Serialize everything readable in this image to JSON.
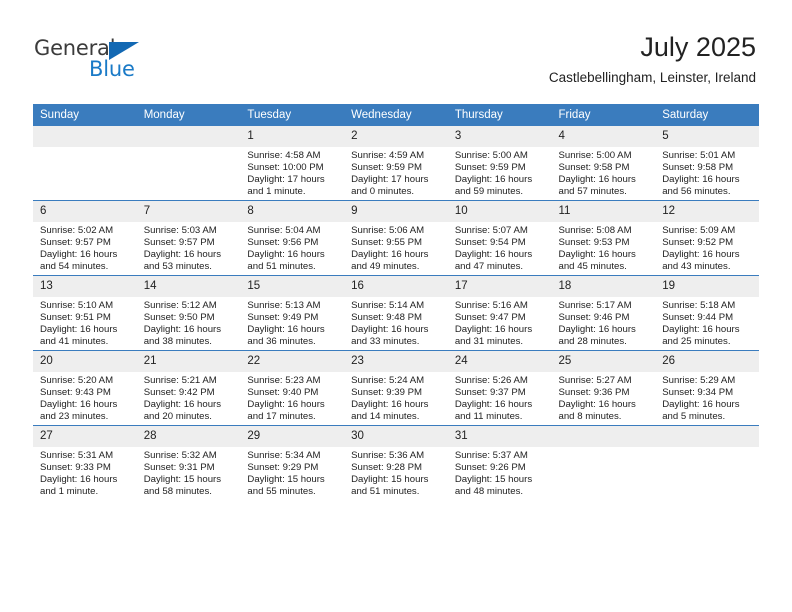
{
  "brand": {
    "name_top": "General",
    "name_bottom": "Blue",
    "accent_color": "#1a7ac7",
    "triangle_color": "#1268b3"
  },
  "header": {
    "title": "July 2025",
    "subtitle": "Castlebellingham, Leinster, Ireland"
  },
  "theme": {
    "header_bg": "#3a7cbe",
    "daynum_bg": "#eeeeee",
    "text": "#222222"
  },
  "weekday_headers": [
    "Sunday",
    "Monday",
    "Tuesday",
    "Wednesday",
    "Thursday",
    "Friday",
    "Saturday"
  ],
  "weeks": [
    [
      {
        "day": "",
        "sunrise": "",
        "sunset": "",
        "daylight1": "",
        "daylight2": "",
        "empty": true
      },
      {
        "day": "",
        "sunrise": "",
        "sunset": "",
        "daylight1": "",
        "daylight2": "",
        "empty": true
      },
      {
        "day": "1",
        "sunrise": "Sunrise: 4:58 AM",
        "sunset": "Sunset: 10:00 PM",
        "daylight1": "Daylight: 17 hours",
        "daylight2": "and 1 minute."
      },
      {
        "day": "2",
        "sunrise": "Sunrise: 4:59 AM",
        "sunset": "Sunset: 9:59 PM",
        "daylight1": "Daylight: 17 hours",
        "daylight2": "and 0 minutes."
      },
      {
        "day": "3",
        "sunrise": "Sunrise: 5:00 AM",
        "sunset": "Sunset: 9:59 PM",
        "daylight1": "Daylight: 16 hours",
        "daylight2": "and 59 minutes."
      },
      {
        "day": "4",
        "sunrise": "Sunrise: 5:00 AM",
        "sunset": "Sunset: 9:58 PM",
        "daylight1": "Daylight: 16 hours",
        "daylight2": "and 57 minutes."
      },
      {
        "day": "5",
        "sunrise": "Sunrise: 5:01 AM",
        "sunset": "Sunset: 9:58 PM",
        "daylight1": "Daylight: 16 hours",
        "daylight2": "and 56 minutes."
      }
    ],
    [
      {
        "day": "6",
        "sunrise": "Sunrise: 5:02 AM",
        "sunset": "Sunset: 9:57 PM",
        "daylight1": "Daylight: 16 hours",
        "daylight2": "and 54 minutes."
      },
      {
        "day": "7",
        "sunrise": "Sunrise: 5:03 AM",
        "sunset": "Sunset: 9:57 PM",
        "daylight1": "Daylight: 16 hours",
        "daylight2": "and 53 minutes."
      },
      {
        "day": "8",
        "sunrise": "Sunrise: 5:04 AM",
        "sunset": "Sunset: 9:56 PM",
        "daylight1": "Daylight: 16 hours",
        "daylight2": "and 51 minutes."
      },
      {
        "day": "9",
        "sunrise": "Sunrise: 5:06 AM",
        "sunset": "Sunset: 9:55 PM",
        "daylight1": "Daylight: 16 hours",
        "daylight2": "and 49 minutes."
      },
      {
        "day": "10",
        "sunrise": "Sunrise: 5:07 AM",
        "sunset": "Sunset: 9:54 PM",
        "daylight1": "Daylight: 16 hours",
        "daylight2": "and 47 minutes."
      },
      {
        "day": "11",
        "sunrise": "Sunrise: 5:08 AM",
        "sunset": "Sunset: 9:53 PM",
        "daylight1": "Daylight: 16 hours",
        "daylight2": "and 45 minutes."
      },
      {
        "day": "12",
        "sunrise": "Sunrise: 5:09 AM",
        "sunset": "Sunset: 9:52 PM",
        "daylight1": "Daylight: 16 hours",
        "daylight2": "and 43 minutes."
      }
    ],
    [
      {
        "day": "13",
        "sunrise": "Sunrise: 5:10 AM",
        "sunset": "Sunset: 9:51 PM",
        "daylight1": "Daylight: 16 hours",
        "daylight2": "and 41 minutes."
      },
      {
        "day": "14",
        "sunrise": "Sunrise: 5:12 AM",
        "sunset": "Sunset: 9:50 PM",
        "daylight1": "Daylight: 16 hours",
        "daylight2": "and 38 minutes."
      },
      {
        "day": "15",
        "sunrise": "Sunrise: 5:13 AM",
        "sunset": "Sunset: 9:49 PM",
        "daylight1": "Daylight: 16 hours",
        "daylight2": "and 36 minutes."
      },
      {
        "day": "16",
        "sunrise": "Sunrise: 5:14 AM",
        "sunset": "Sunset: 9:48 PM",
        "daylight1": "Daylight: 16 hours",
        "daylight2": "and 33 minutes."
      },
      {
        "day": "17",
        "sunrise": "Sunrise: 5:16 AM",
        "sunset": "Sunset: 9:47 PM",
        "daylight1": "Daylight: 16 hours",
        "daylight2": "and 31 minutes."
      },
      {
        "day": "18",
        "sunrise": "Sunrise: 5:17 AM",
        "sunset": "Sunset: 9:46 PM",
        "daylight1": "Daylight: 16 hours",
        "daylight2": "and 28 minutes."
      },
      {
        "day": "19",
        "sunrise": "Sunrise: 5:18 AM",
        "sunset": "Sunset: 9:44 PM",
        "daylight1": "Daylight: 16 hours",
        "daylight2": "and 25 minutes."
      }
    ],
    [
      {
        "day": "20",
        "sunrise": "Sunrise: 5:20 AM",
        "sunset": "Sunset: 9:43 PM",
        "daylight1": "Daylight: 16 hours",
        "daylight2": "and 23 minutes."
      },
      {
        "day": "21",
        "sunrise": "Sunrise: 5:21 AM",
        "sunset": "Sunset: 9:42 PM",
        "daylight1": "Daylight: 16 hours",
        "daylight2": "and 20 minutes."
      },
      {
        "day": "22",
        "sunrise": "Sunrise: 5:23 AM",
        "sunset": "Sunset: 9:40 PM",
        "daylight1": "Daylight: 16 hours",
        "daylight2": "and 17 minutes."
      },
      {
        "day": "23",
        "sunrise": "Sunrise: 5:24 AM",
        "sunset": "Sunset: 9:39 PM",
        "daylight1": "Daylight: 16 hours",
        "daylight2": "and 14 minutes."
      },
      {
        "day": "24",
        "sunrise": "Sunrise: 5:26 AM",
        "sunset": "Sunset: 9:37 PM",
        "daylight1": "Daylight: 16 hours",
        "daylight2": "and 11 minutes."
      },
      {
        "day": "25",
        "sunrise": "Sunrise: 5:27 AM",
        "sunset": "Sunset: 9:36 PM",
        "daylight1": "Daylight: 16 hours",
        "daylight2": "and 8 minutes."
      },
      {
        "day": "26",
        "sunrise": "Sunrise: 5:29 AM",
        "sunset": "Sunset: 9:34 PM",
        "daylight1": "Daylight: 16 hours",
        "daylight2": "and 5 minutes."
      }
    ],
    [
      {
        "day": "27",
        "sunrise": "Sunrise: 5:31 AM",
        "sunset": "Sunset: 9:33 PM",
        "daylight1": "Daylight: 16 hours",
        "daylight2": "and 1 minute."
      },
      {
        "day": "28",
        "sunrise": "Sunrise: 5:32 AM",
        "sunset": "Sunset: 9:31 PM",
        "daylight1": "Daylight: 15 hours",
        "daylight2": "and 58 minutes."
      },
      {
        "day": "29",
        "sunrise": "Sunrise: 5:34 AM",
        "sunset": "Sunset: 9:29 PM",
        "daylight1": "Daylight: 15 hours",
        "daylight2": "and 55 minutes."
      },
      {
        "day": "30",
        "sunrise": "Sunrise: 5:36 AM",
        "sunset": "Sunset: 9:28 PM",
        "daylight1": "Daylight: 15 hours",
        "daylight2": "and 51 minutes."
      },
      {
        "day": "31",
        "sunrise": "Sunrise: 5:37 AM",
        "sunset": "Sunset: 9:26 PM",
        "daylight1": "Daylight: 15 hours",
        "daylight2": "and 48 minutes."
      },
      {
        "day": "",
        "sunrise": "",
        "sunset": "",
        "daylight1": "",
        "daylight2": "",
        "empty": true
      },
      {
        "day": "",
        "sunrise": "",
        "sunset": "",
        "daylight1": "",
        "daylight2": "",
        "empty": true
      }
    ]
  ]
}
